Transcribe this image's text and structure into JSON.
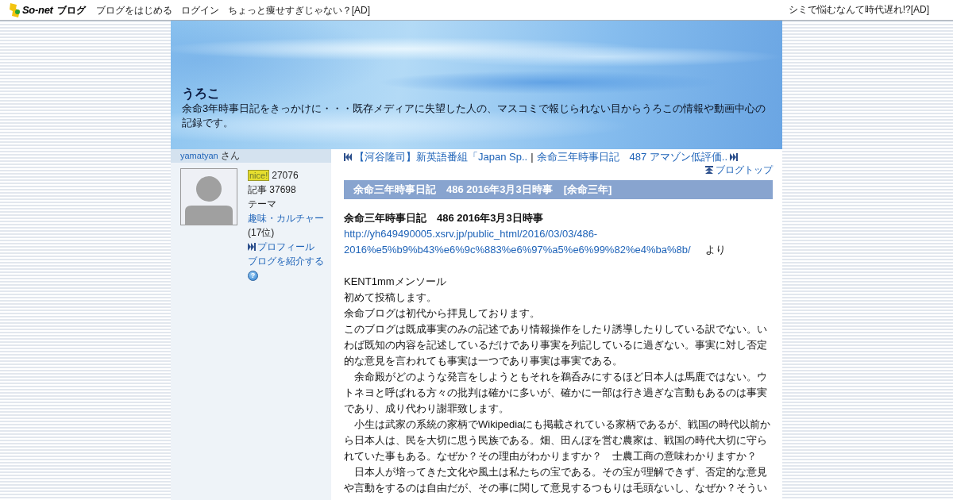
{
  "top_bar": {
    "logo": {
      "brand": "So-net",
      "product": "ブログ"
    },
    "links": [
      "ブログをはじめる",
      "ログイン",
      "ちょっと痩せすぎじゃない？[AD]"
    ],
    "right_ad": "シミで悩むなんて時代遅れ!?[AD]"
  },
  "header": {
    "title": "うろこ",
    "description": "余命3年時事日記をきっかけに・・・既存メディアに失望した人の、マスコミで報じられない目からうろこの情報や動画中心の記録です。"
  },
  "sidebar": {
    "user": "yamatyan",
    "user_suffix": "さん",
    "nice_label": "nice!",
    "nice_count": "27076",
    "articles": "記事 37698",
    "theme_label": "テーマ",
    "theme": "趣味・カルチャー",
    "theme_rank": "(17位)",
    "profile_link": "プロフィール",
    "share_link": "ブログを紹介する",
    "help_symbol": "?"
  },
  "post_nav": {
    "previous": "【河谷隆司】新英語番組「Japan Sp..",
    "separator": "|",
    "next": "余命三年時事日記　487 アマゾン低評価..",
    "blog_top": "ブログトップ"
  },
  "post": {
    "title": "余命三年時事日記　486 2016年3月3日時事",
    "category": "[余命三年]",
    "heading": "余命三年時事日記　486 2016年3月3日時事",
    "source_url": "http://yh649490005.xsrv.jp/public_html/2016/03/03/486-2016%e5%b9%b43%e6%9c%883%e6%97%a5%e6%99%82%e4%ba%8b/",
    "source_suffix": "より",
    "paragraphs": [
      "KENT1mmメンソール",
      "初めて投稿します。",
      "余命ブログは初代から拝見しております。",
      "このブログは既成事実のみの記述であり情報操作をしたり誘導したりしている訳でない。いわば既知の内容を記述しているだけであり事実を列記しているに過ぎない。事実に対し否定的な意見を言われても事実は一つであり事実は事実である。",
      "　余命殿がどのような発言をしようともそれを鵜呑みにするほど日本人は馬鹿ではない。ウトネヨと呼ばれる方々の批判は確かに多いが、確かに一部は行き過ぎな言動もあるのは事実であり、成り代わり謝罪致します。",
      "　小生は武家の系統の家柄でWikipediaにも掲載されている家柄であるが、戦国の時代以前から日本人は、民を大切に思う民族である。畑、田んぼを営む農家は、戦国の時代大切に守られていた事もある。なぜか？その理由がわかりますか？　士農工商の意味わかりますか？",
      "　日本人が培ってきた文化や風土は私たちの宝である。その宝が理解できず、否定的な意見や言動をするのは自由だが、その事に関して意見するつもりは毛頭ないし、なぜか？そうい"
    ]
  }
}
